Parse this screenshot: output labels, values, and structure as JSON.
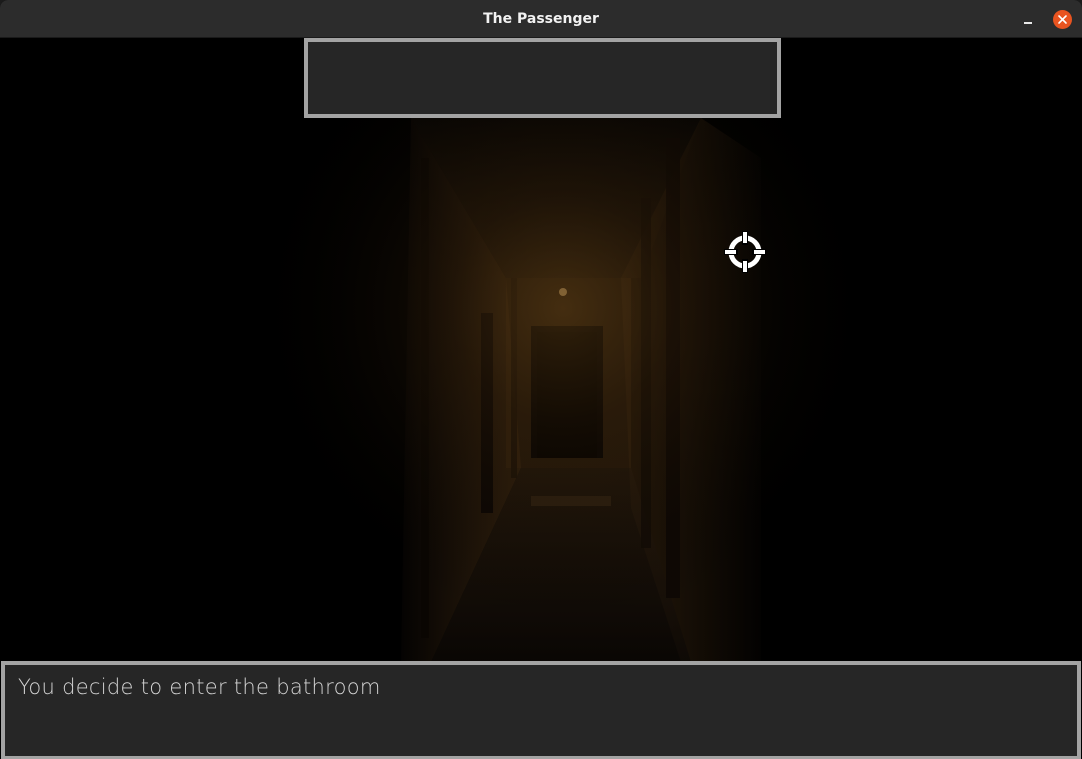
{
  "window": {
    "title": "The Passenger"
  },
  "titlebar_buttons": {
    "minimize_icon": "minimize-icon",
    "close_icon": "close-icon",
    "close_color": "#e95420"
  },
  "hud": {
    "top_box_text": "",
    "cursor_icon": "crosshair-icon"
  },
  "dialog": {
    "text": "You decide to enter the bathroom"
  },
  "colors": {
    "panel_border": "#a3a3a3",
    "panel_fill": "#262626",
    "text": "#d4d4d4"
  }
}
